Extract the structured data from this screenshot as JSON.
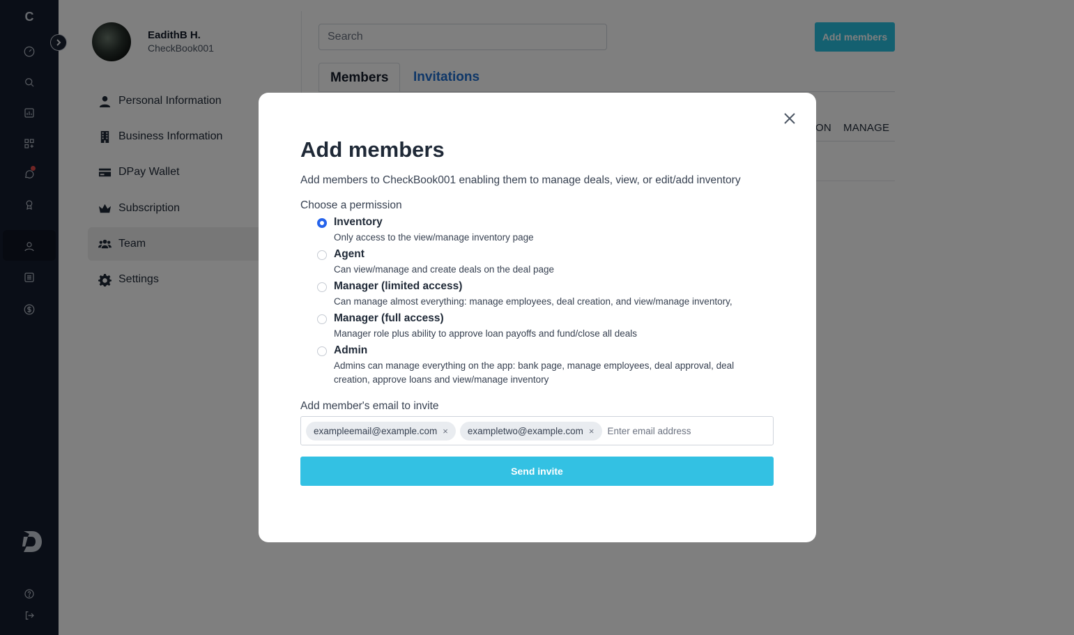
{
  "rail": {
    "brand": "C",
    "icons": [
      "gauge-icon",
      "search-icon",
      "chart-icon",
      "apps-icon",
      "chat-icon",
      "award-icon",
      "user-icon",
      "list-icon",
      "dollar-icon",
      "help-icon",
      "logout-icon"
    ],
    "notification_color": "#e24b4b"
  },
  "profile": {
    "name": "EadithB H.",
    "company": "CheckBook001"
  },
  "settings_nav": [
    {
      "label": "Personal Information",
      "icon": "person-icon"
    },
    {
      "label": "Business Information",
      "icon": "building-icon"
    },
    {
      "label": "DPay Wallet",
      "icon": "card-icon"
    },
    {
      "label": "Subscription",
      "icon": "crown-icon"
    },
    {
      "label": "Team",
      "icon": "team-icon",
      "active": true
    },
    {
      "label": "Settings",
      "icon": "gear-icon"
    }
  ],
  "main": {
    "search_placeholder": "Search",
    "add_members_label": "Add members",
    "tabs": [
      "Members",
      "Invitations"
    ],
    "columns_visible": [
      "ON",
      "MANAGE"
    ]
  },
  "modal": {
    "title": "Add members",
    "description": "Add members to CheckBook001 enabling them to manage deals, view, or edit/add inventory",
    "permission_label": "Choose a permission",
    "options": [
      {
        "title": "Inventory",
        "desc": "Only access to the view/manage inventory page",
        "checked": true
      },
      {
        "title": "Agent",
        "desc": "Can view/manage and create deals on the deal page",
        "checked": false
      },
      {
        "title": "Manager (limited access)",
        "desc": "Can manage almost everything: manage employees, deal creation, and view/manage inventory,",
        "checked": false
      },
      {
        "title": "Manager (full access)",
        "desc": "Manager role plus ability to approve loan payoffs and fund/close all deals",
        "checked": false
      },
      {
        "title": "Admin",
        "desc": "Admins can manage everything on the app: bank page, manage employees, deal approval, deal creation, approve loans and view/manage inventory",
        "checked": false
      }
    ],
    "email_label": "Add member's email to invite",
    "emails": [
      "exampleemail@example.com",
      "exampletwo@example.com"
    ],
    "chip_remove": "×",
    "email_placeholder": "Enter email address",
    "send_label": "Send invite"
  },
  "colors": {
    "rail_bg": "#151d2e",
    "accent": "#29c0e0",
    "send_button": "#33c1e3",
    "radio_checked": "#2563eb",
    "tab_active_link": "#1f6fd1"
  }
}
